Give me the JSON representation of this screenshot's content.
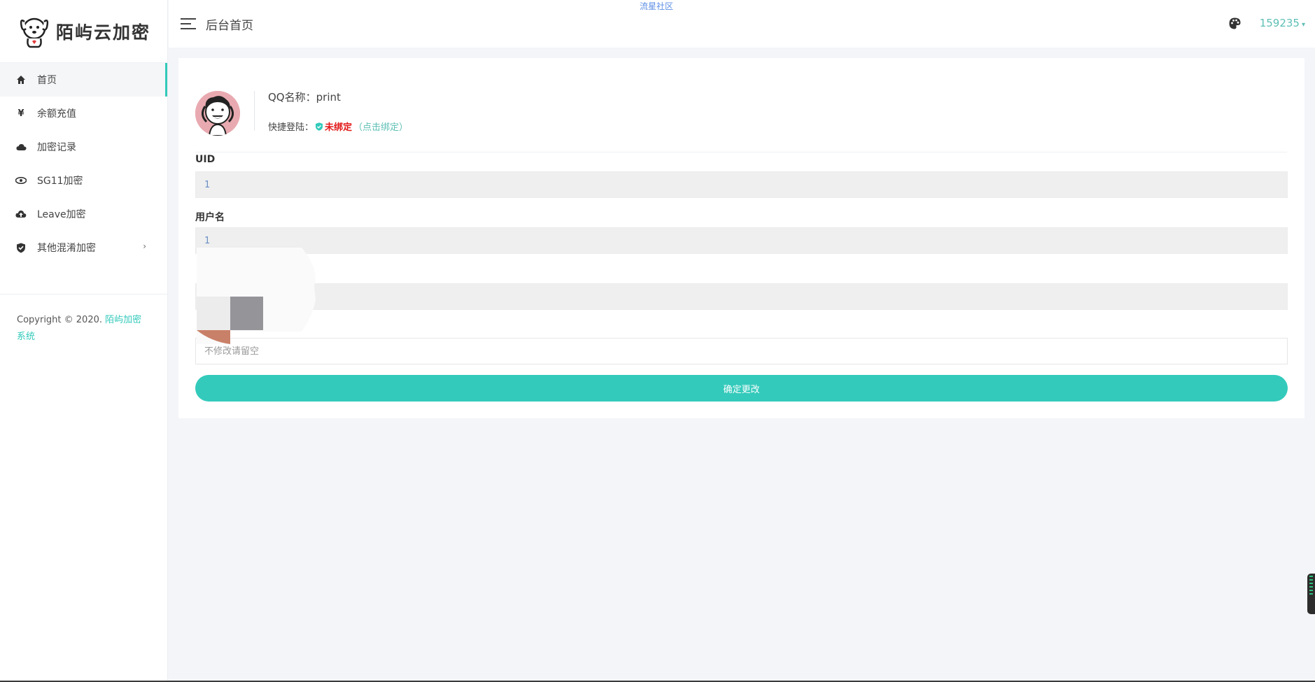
{
  "brand": {
    "name": "陌屿云加密"
  },
  "header": {
    "page_title": "后台首页",
    "top_link": "流星社区",
    "user": "159235"
  },
  "sidebar": {
    "items": [
      {
        "label": "首页",
        "icon": "home-icon",
        "active": true
      },
      {
        "label": "余额充值",
        "icon": "yen-icon"
      },
      {
        "label": "加密记录",
        "icon": "cloud-icon"
      },
      {
        "label": "SG11加密",
        "icon": "eye-icon"
      },
      {
        "label": "Leave加密",
        "icon": "cloud-upload-icon"
      },
      {
        "label": "其他混淆加密",
        "icon": "shield-check-icon",
        "has_submenu": true
      }
    ],
    "copyright_prefix": "Copyright © 2020. ",
    "copyright_link": "陌屿加密系统"
  },
  "profile": {
    "qq_name_label": "QQ名称：",
    "qq_name": "print",
    "quick_login_label": "快捷登陆：",
    "quick_login_status": "未绑定",
    "bind_link": "（点击绑定）"
  },
  "form": {
    "uid_label": "UID",
    "uid_value": "1",
    "username_label": "用户名",
    "username_value": "1",
    "password_placeholder": "不修改请留空",
    "submit_label": "确定更改"
  },
  "colors": {
    "accent": "#33cabb",
    "danger": "#e21818",
    "link": "#5dbfb5"
  }
}
